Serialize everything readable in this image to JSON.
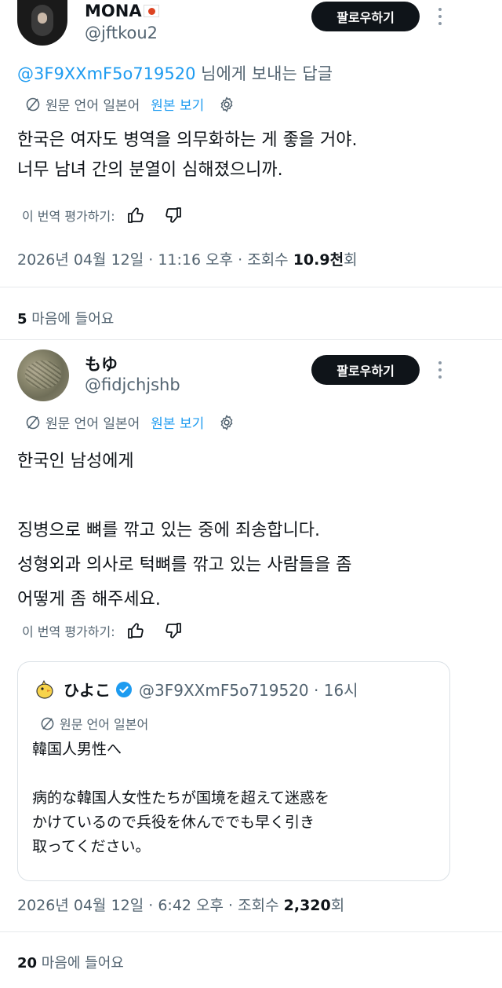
{
  "tweet1": {
    "name": "MONA",
    "flag": "🇯🇵",
    "handle": "@jftkou2",
    "follow_label": "팔로우하기",
    "reply_to_handle": "@3F9XXmF5o719520",
    "reply_to_suffix": " 님에게 보내는 답글",
    "lang_note": "원문 언어 일본어",
    "view_original": "원본 보기",
    "text": "한국은 여자도 병역을 의무화하는 게 좋을 거야.\n너무 남녀 간의 분열이 심해졌으니까.",
    "rate_label": "이 번역 평가하기:",
    "meta_prefix": "2026년 04월 12일 · 11:16 오후 · 조회수 ",
    "views": "10.9천",
    "views_suffix": "회",
    "likes_count": "5",
    "likes_label": " 마음에 들어요"
  },
  "tweet2": {
    "name": "もゆ",
    "handle": "@fidjchjshb",
    "follow_label": "팔로우하기",
    "lang_note": "원문 언어 일본어",
    "view_original": "원본 보기",
    "text": "한국인 남성에게\n\n징병으로 뼈를 깎고 있는 중에 죄송합니다.\n성형외과 의사로 턱뼈를 깎고 있는 사람들을 좀\n어떻게 좀 해주세요.",
    "rate_label": "이 번역 평가하기:",
    "quote": {
      "name": "ひよこ",
      "handle_time": "@3F9XXmF5o719520 · 16시",
      "lang_note": "원문 언어 일본어",
      "text": "韓国人男性へ\n\n病的な韓国人女性たちが国境を超えて迷惑を\nかけているので兵役を休んででも早く引き\n取ってください。"
    },
    "meta_prefix": "2026년 04월 12일 · 6:42 오후 · 조회수 ",
    "views": "2,320",
    "views_suffix": "회",
    "likes_count": "20",
    "likes_label": " 마음에 들어요"
  },
  "colors": {
    "accent": "#1d9bf0",
    "text": "#0f1419",
    "muted": "#536471",
    "button": "#0f1419"
  }
}
